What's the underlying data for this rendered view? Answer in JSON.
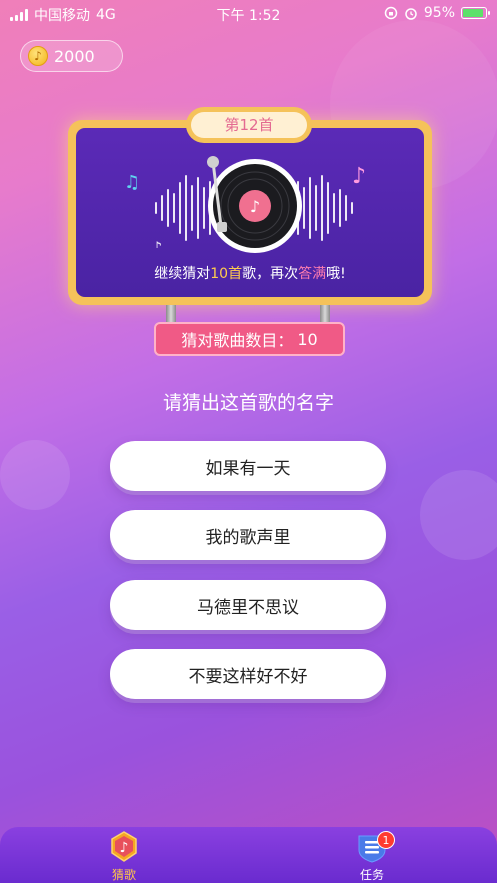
{
  "status_bar": {
    "carrier": "中国移动",
    "network": "4G",
    "time": "下午 1:52",
    "battery_percent": "95%",
    "battery_level": 0.95
  },
  "coins": {
    "amount": "2000",
    "icon": "music-coin-icon"
  },
  "board": {
    "level_label": "第12首",
    "message_prefix": "继续猜对",
    "message_count": "10首",
    "message_middle": "歌，再次",
    "message_highlight": "答满",
    "message_suffix": "哦!",
    "score_label": "猜对歌曲数目：",
    "score_value": "10"
  },
  "question": "请猜出这首歌的名字",
  "options": [
    {
      "label": "如果有一天"
    },
    {
      "label": "我的歌声里"
    },
    {
      "label": "马德里不思议"
    },
    {
      "label": "不要这样好不好"
    }
  ],
  "tabbar": {
    "tabs": [
      {
        "label": "猜歌",
        "icon": "music-note-badge-icon",
        "active": true
      },
      {
        "label": "任务",
        "icon": "task-list-shield-icon",
        "active": false
      }
    ],
    "task_badge": "1"
  },
  "colors": {
    "accent_gold": "#f5c25a",
    "board_purple": "#4a23a3",
    "score_pink": "#f05a86",
    "tab_active": "#ffc64a"
  }
}
